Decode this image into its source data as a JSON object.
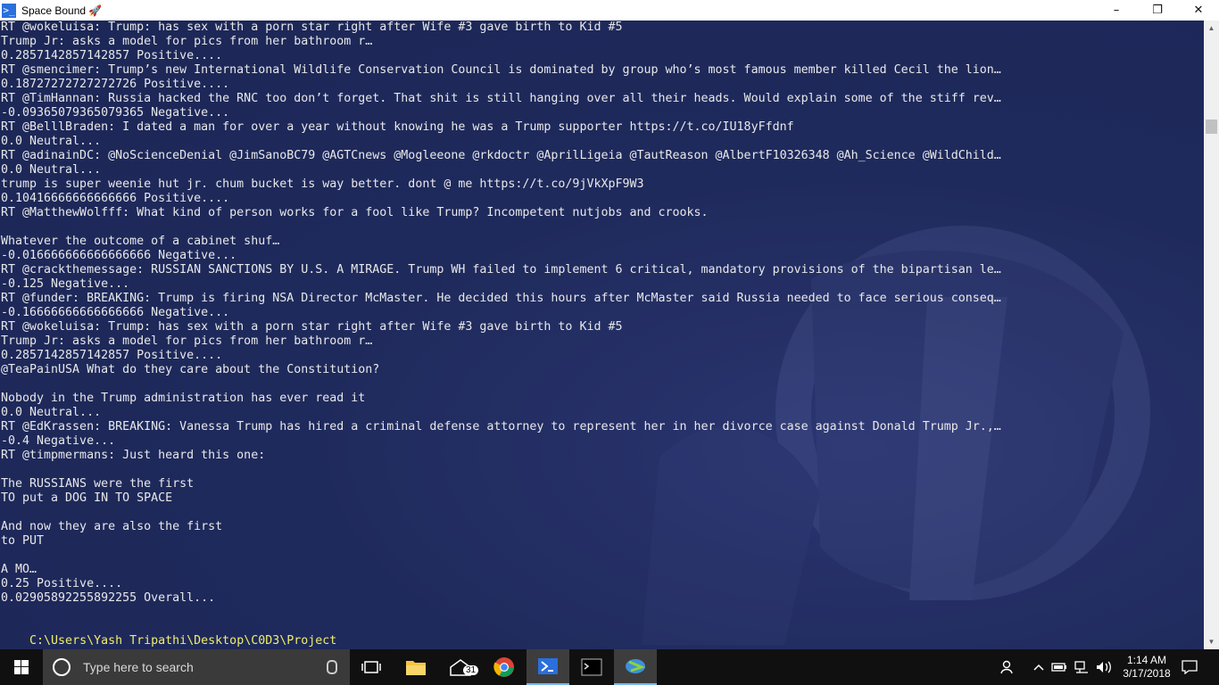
{
  "window": {
    "title": "Space Bound 🚀",
    "minimize": "–",
    "maximize": "❐",
    "close": "✕"
  },
  "console": {
    "lines": [
      "RT @wokeluisa: Trump: has sex with a porn star right after Wife #3 gave birth to Kid #5",
      "Trump Jr: asks a model for pics from her bathroom r…",
      "0.2857142857142857 Positive....",
      "RT @smencimer: Trump’s new International Wildlife Conservation Council is dominated by group who’s most famous member killed Cecil the lion…",
      "0.18727272727272726 Positive....",
      "RT @TimHannan: Russia hacked the RNC too don’t forget. That shit is still hanging over all their heads. Would explain some of the stiff rev…",
      "-0.09365079365079365 Negative...",
      "RT @BelllBraden: I dated a man for over a year without knowing he was a Trump supporter https://t.co/IU18yFfdnf",
      "0.0 Neutral...",
      "RT @adinainDC: @NoScienceDenial @JimSanoBC79 @AGTCnews @Mogleeone @rkdoctr @AprilLigeia @TautReason @AlbertF10326348 @Ah_Science @WildChild…",
      "0.0 Neutral...",
      "trump is super weenie hut jr. chum bucket is way better. dont @ me https://t.co/9jVkXpF9W3",
      "0.10416666666666666 Positive....",
      "RT @MatthewWolfff: What kind of person works for a fool like Trump? Incompetent nutjobs and crooks.",
      "",
      "Whatever the outcome of a cabinet shuf…",
      "-0.016666666666666666 Negative...",
      "RT @crackthemessage: RUSSIAN SANCTIONS BY U.S. A MIRAGE. Trump WH failed to implement 6 critical, mandatory provisions of the bipartisan le…",
      "-0.125 Negative...",
      "RT @funder: BREAKING: Trump is firing NSA Director McMaster. He decided this hours after McMaster said Russia needed to face serious conseq…",
      "-0.16666666666666666 Negative...",
      "RT @wokeluisa: Trump: has sex with a porn star right after Wife #3 gave birth to Kid #5",
      "Trump Jr: asks a model for pics from her bathroom r…",
      "0.2857142857142857 Positive....",
      "@TeaPainUSA What do they care about the Constitution?",
      "",
      "Nobody in the Trump administration has ever read it",
      "0.0 Neutral...",
      "RT @EdKrassen: BREAKING: Vanessa Trump has hired a criminal defense attorney to represent her in her divorce case against Donald Trump Jr.,…",
      "-0.4 Negative...",
      "RT @timpmermans: Just heard this one:",
      "",
      "The RUSSIANS were the first",
      "TO put a DOG IN TO SPACE",
      "",
      "And now they are also the first",
      "to PUT",
      "",
      "A MO…",
      "0.25 Positive....",
      "0.02905892255892255 Overall...",
      ""
    ],
    "prompt_path": "C:\\Users\\Yash Tripathi\\Desktop\\C0D3\\Project",
    "prompt_symbol": ">>>"
  },
  "taskbar": {
    "search_placeholder": "Type here to search",
    "mail_badge": "31",
    "clock_time": "1:14 AM",
    "clock_date": "3/17/2018"
  }
}
